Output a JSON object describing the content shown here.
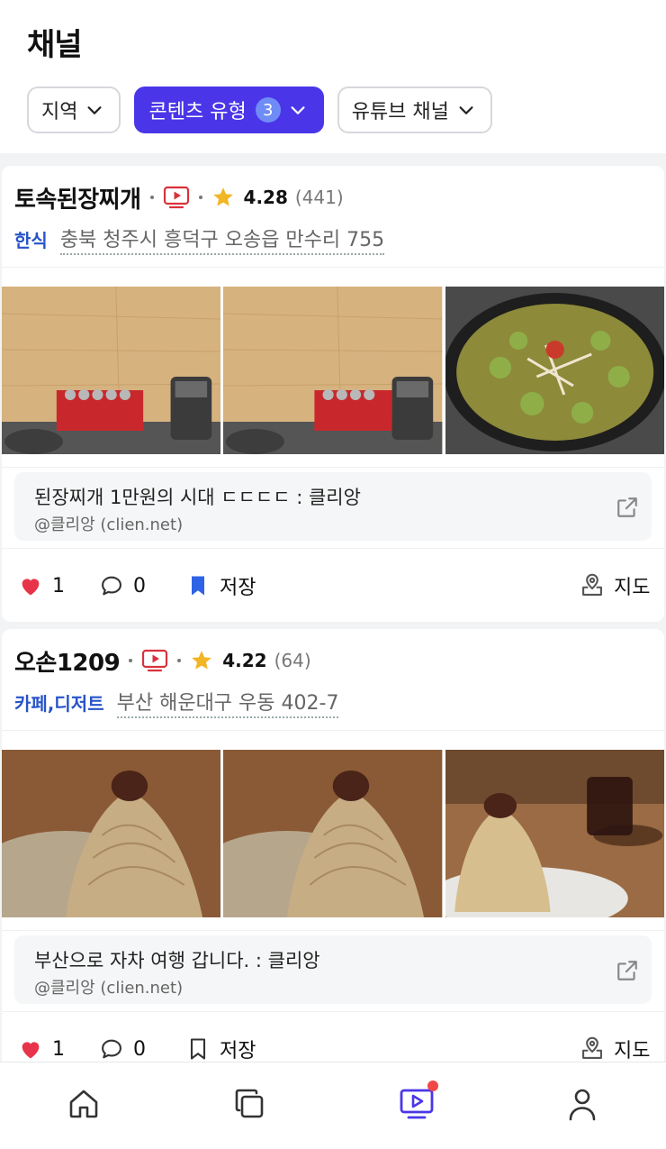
{
  "header": {
    "title": "채널",
    "filters": [
      {
        "label": "지역",
        "active": false
      },
      {
        "label": "콘텐츠 유형",
        "count": "3",
        "active": true
      },
      {
        "label": "유튜브 채널",
        "active": false
      }
    ]
  },
  "cards": [
    {
      "name": "토속된장찌개",
      "rating": "4.28",
      "reviews": "(441)",
      "category": "한식",
      "address": "충북 청주시 흥덕구 오송읍 만수리 755",
      "link_title": "된장찌개 1만원의 시대 ㄷㄷㄷㄷ : 클리앙",
      "link_source": "@클리앙 (clien.net)",
      "likes": "1",
      "comments": "0",
      "save_label": "저장",
      "saved": true,
      "map_label": "지도"
    },
    {
      "name": "오손1209",
      "rating": "4.22",
      "reviews": "(64)",
      "category": "카페,디저트",
      "address": "부산 해운대구 우동 402-7",
      "link_title": "부산으로 자차 여행 갑니다. : 클리앙",
      "link_source": "@클리앙 (clien.net)",
      "likes": "1",
      "comments": "0",
      "save_label": "저장",
      "saved": false,
      "map_label": "지도"
    }
  ],
  "icons": {
    "youtube": "youtube-icon",
    "star": "star-icon",
    "heart": "heart-icon",
    "comment": "comment-icon",
    "bookmark": "bookmark-icon",
    "map": "map-pin-icon",
    "external": "external-link-icon"
  },
  "colors": {
    "accent": "#4a36e8",
    "heart": "#e8344a",
    "bookmark": "#2f63e6",
    "category": "#2753c9",
    "star": "#f2b524",
    "youtube": "#d8323c"
  },
  "bottom_nav": [
    {
      "name": "home-icon"
    },
    {
      "name": "copy-icon"
    },
    {
      "name": "channel-icon",
      "active": true,
      "badge": true
    },
    {
      "name": "profile-icon"
    }
  ]
}
